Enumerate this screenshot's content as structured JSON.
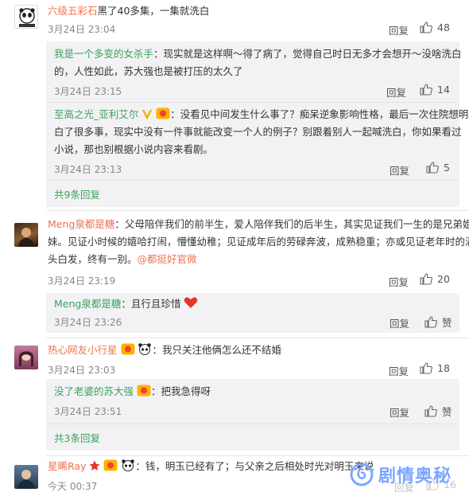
{
  "c1": {
    "username": "六级五彩石",
    "text": "黑了40多集，一集就洗白",
    "time": "3月24日 23:04",
    "reply": "回复",
    "likes": "48"
  },
  "c1_replies": [
    {
      "username": "我是一个多变的女杀手",
      "line1": "：现实就是这样啊～得了病了，觉得自己时日无多才会想开～没啥洗白",
      "line2": "的，人性如此，苏大强也是被打压的太久了",
      "time": "3月24日 23:15",
      "reply": "回复",
      "likes": "14"
    },
    {
      "username": "至高之光_亚利艾尔",
      "line1": "：没看见中间发生什么事了？痴呆逆象影响性格，最后一次住院想明",
      "line2": "白了很多事，现实中没有一件事就能改变一个人的例子？别跟着别人一起喊洗白，你如果看过",
      "line3": "小说，那也别根据小说内容来看剧。",
      "time": "3月24日 23:13",
      "reply": "回复",
      "likes": "5"
    }
  ],
  "c1_more": "共9条回复",
  "c2": {
    "username": "Meng泉都是糖",
    "line1": "：父母陪伴我们的前半生，爱人陪伴我们的后半生，其实见证我们一生的是兄弟姐",
    "line2": "妹。见证小时候的嬉哈打闹，懵懂幼稚；见证成年后的劳碌奔波，成熟稳重；亦或见证老年时的满",
    "line3": "头白发，终有一别。",
    "mention": "@都挺好官微",
    "time": "3月24日 23:19",
    "reply": "回复",
    "likes": "20"
  },
  "c2_reply": {
    "username": "Meng泉都是糖",
    "text": "：且行且珍惜",
    "time": "3月24日 23:26",
    "reply": "回复",
    "likes": "赞"
  },
  "c3": {
    "username": "热心网友小行星",
    "text": "：我只关注他俩怎么还不结婚",
    "time": "3月24日 23:03",
    "reply": "回复",
    "likes": "18"
  },
  "c3_reply": {
    "username": "没了老婆的苏大强",
    "text": "：把我急得呀",
    "time": "3月24日 23:51",
    "reply": "回复",
    "likes": "赞"
  },
  "c3_more": "共3条回复",
  "c4": {
    "username": "星晞Ray",
    "text": "：钱，明玉已经有了；与父亲之后相处时光对明玉来说",
    "time": "今天 00:37",
    "reply": "回复",
    "likes": "16"
  },
  "watermark": "剧情奥秘",
  "colors": {
    "username": "#eb7350",
    "link": "#3aa35a",
    "meta": "#888888",
    "subbox": "#f2f2f5"
  }
}
